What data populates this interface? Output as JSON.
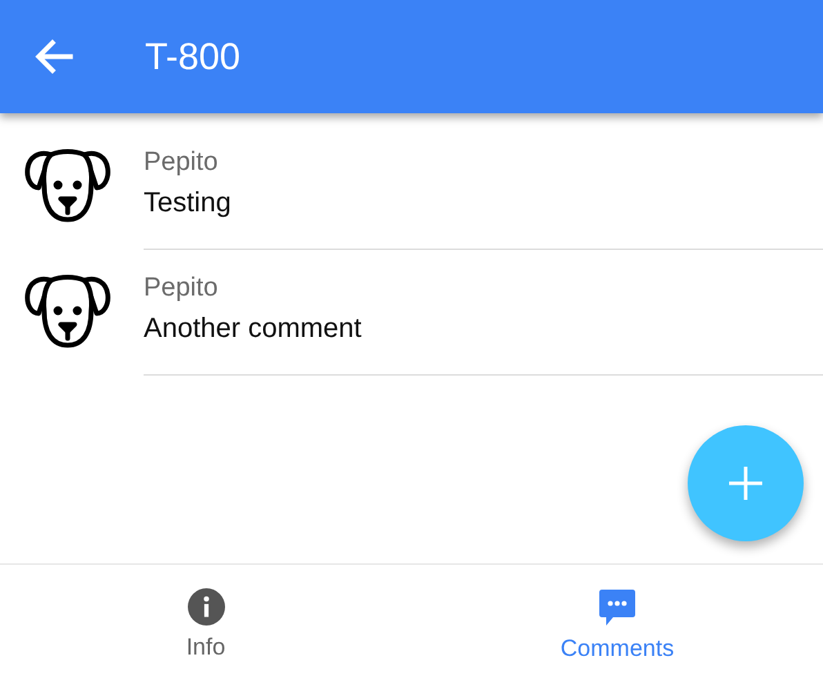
{
  "app_bar": {
    "title": "T-800"
  },
  "comments": [
    {
      "author": "Pepito",
      "text": "Testing"
    },
    {
      "author": "Pepito",
      "text": "Another comment"
    }
  ],
  "bottom_nav": [
    {
      "label": "Info",
      "kind": "info",
      "selected": false
    },
    {
      "label": "Comments",
      "kind": "comments",
      "selected": true
    }
  ]
}
